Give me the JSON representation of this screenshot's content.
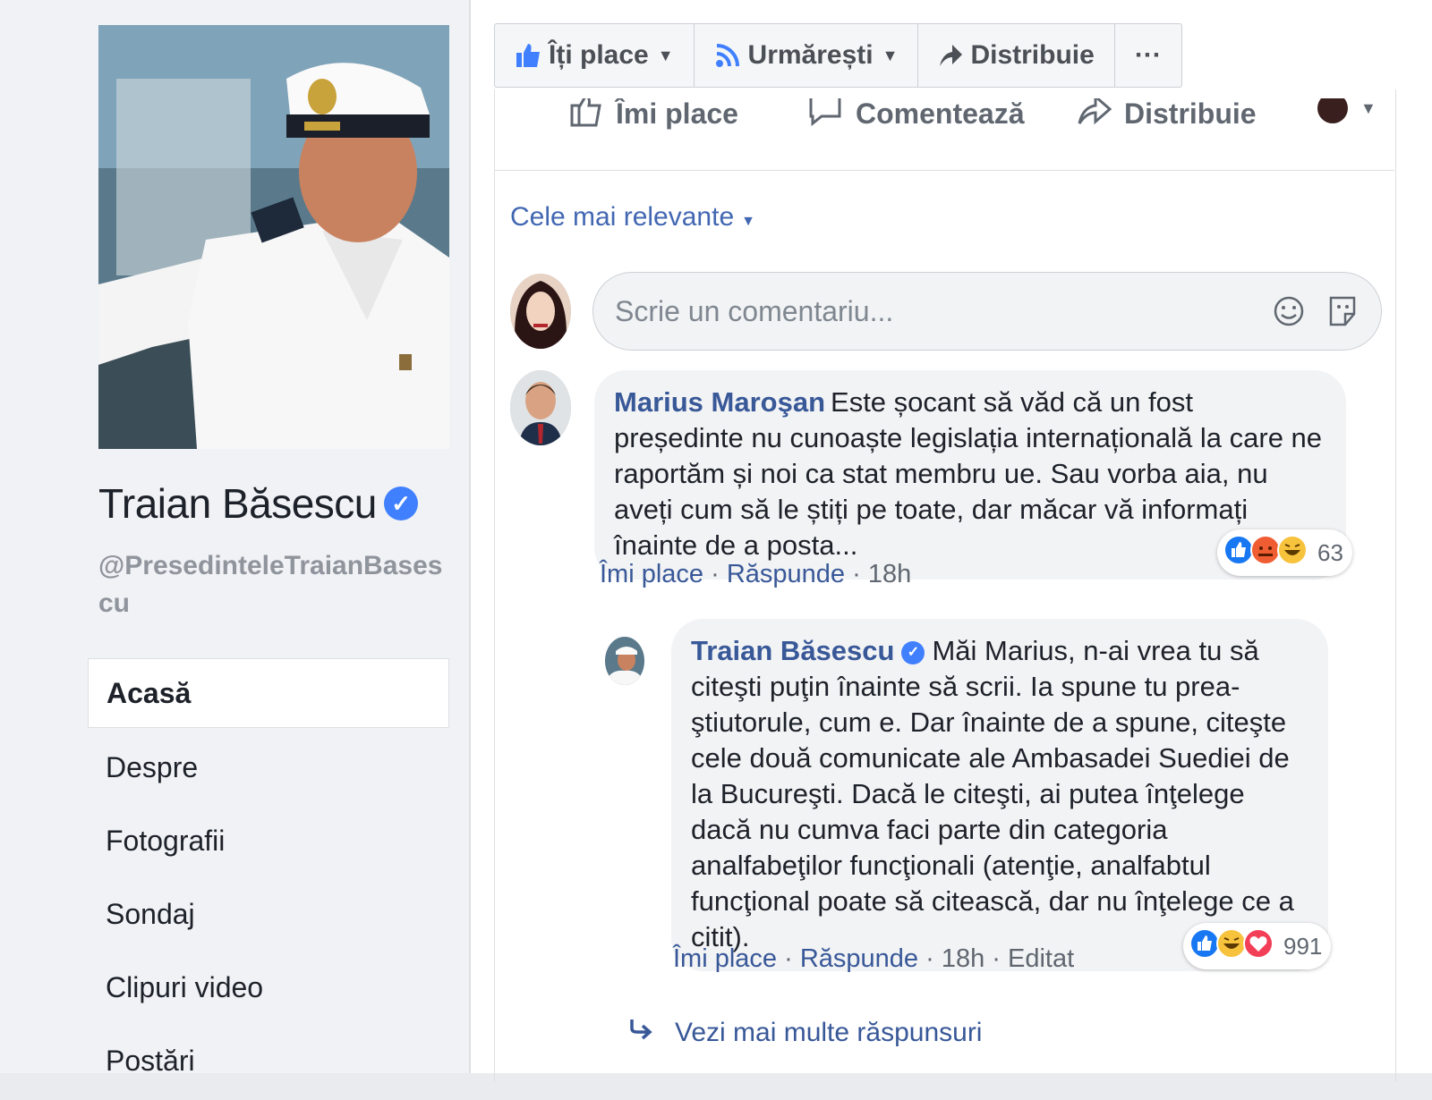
{
  "profile": {
    "name": "Traian Băsescu",
    "handle": "@PresedinteleTraianBasescu",
    "nav": [
      "Acasă",
      "Despre",
      "Fotografii",
      "Sondaj",
      "Clipuri video",
      "Postări"
    ]
  },
  "toolbar": {
    "like_label": "Îți place",
    "follow_label": "Urmărești",
    "share_label": "Distribuie",
    "more_label": "···"
  },
  "actions": {
    "like": "Îmi place",
    "comment": "Comentează",
    "share": "Distribuie"
  },
  "sort_label": "Cele mai relevante",
  "composer": {
    "placeholder": "Scrie un comentariu..."
  },
  "comments": [
    {
      "author": "Marius Maroşan",
      "text": "Este șocant să văd că un fost președinte nu cunoaște legislația internațională la care ne raportăm și noi ca stat membru ue. Sau vorba aia, nu aveți cum să le știți pe toate, dar măcar vă informați înainte de a posta...",
      "like_label": "Îmi place",
      "reply_label": "Răspunde",
      "time": "18h",
      "reaction_count": "63"
    },
    {
      "author": "Traian Băsescu",
      "text": "Măi Marius, n-ai vrea tu să citeşti puţin înainte să scrii. Ia spune tu prea-ştiutorule, cum e. Dar înainte de a spune, citeşte cele două comunicate ale Ambasadei Suediei de la Bucureşti. Dacă le citeşti, ai putea înţelege dacă nu cumva faci parte din categoria analfabeţilor funcţionali (atenţie, analfabtul funcţional poate să citească, dar nu înţelege ce a citit).",
      "like_label": "Îmi place",
      "reply_label": "Răspunde",
      "time": "18h",
      "edited_label": "Editat",
      "reaction_count": "991"
    }
  ],
  "more_replies_label": "Vezi mai multe răspunsuri",
  "colors": {
    "link": "#385898",
    "accent": "#4080ff",
    "bubble": "#f2f3f5"
  }
}
